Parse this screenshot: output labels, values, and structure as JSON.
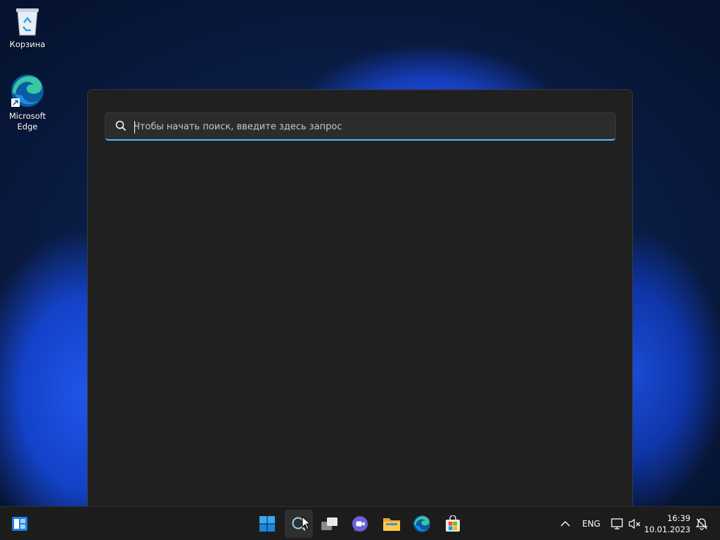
{
  "desktop": {
    "icons": [
      {
        "label": "Корзина",
        "icon": "recycle-bin-icon"
      },
      {
        "label": "Microsoft Edge",
        "label_line1": "Microsoft",
        "label_line2": "Edge",
        "icon": "edge-icon"
      }
    ]
  },
  "search": {
    "placeholder": "Чтобы начать поиск, введите здесь запрос",
    "value": "",
    "accent_color": "#4cc2ff"
  },
  "taskbar": {
    "left": [
      {
        "icon": "widgets-icon"
      }
    ],
    "center": [
      {
        "icon": "start-icon"
      },
      {
        "icon": "search-icon",
        "active": true
      },
      {
        "icon": "task-view-icon"
      },
      {
        "icon": "teams-chat-icon"
      },
      {
        "icon": "file-explorer-icon"
      },
      {
        "icon": "edge-icon"
      },
      {
        "icon": "microsoft-store-icon"
      }
    ],
    "tray": {
      "language": "ENG",
      "time": "16:39",
      "date": "10.01.2023",
      "icons": [
        "show-hidden-icons-chevron-icon",
        "network-icon",
        "volume-muted-icon",
        "notifications-icon"
      ]
    }
  }
}
